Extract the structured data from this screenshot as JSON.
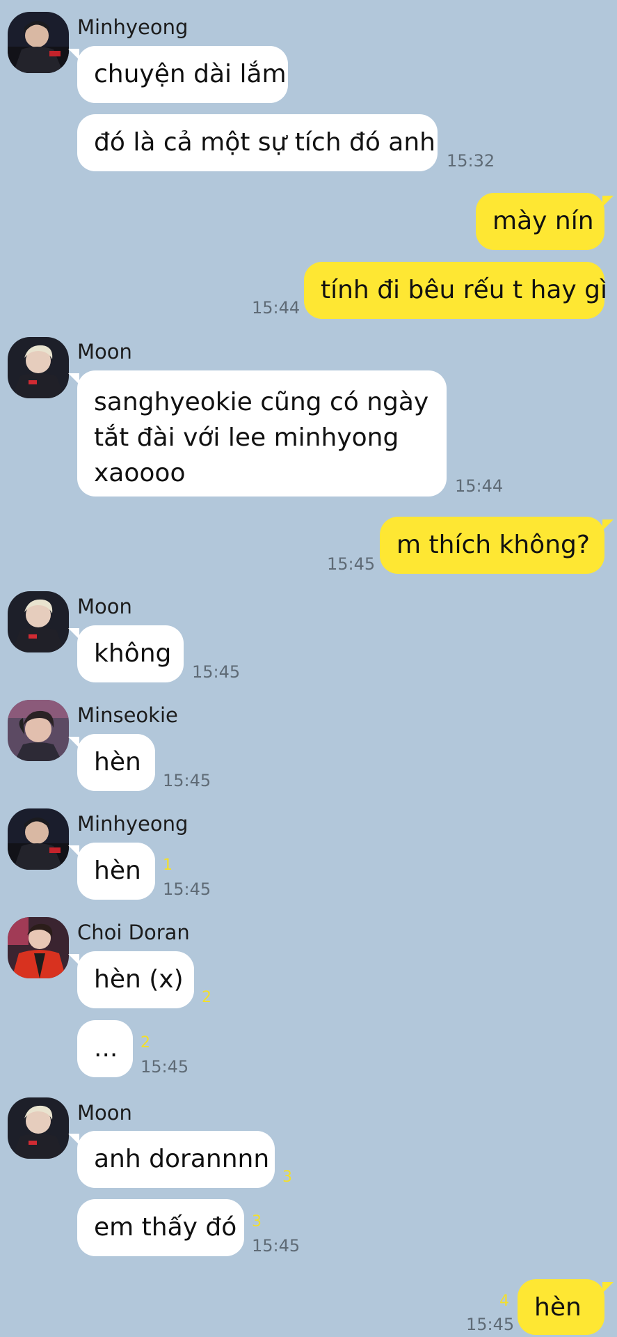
{
  "senders": {
    "minhyeong": "Minhyeong",
    "moon": "Moon",
    "minseokie": "Minseokie",
    "choi_doran": "Choi Doran"
  },
  "avatars": {
    "minhyeong": "minhyeong-avatar-photo",
    "moon": "moon-avatar-photo",
    "minseokie": "minseokie-avatar-photo",
    "choi_doran": "choi-doran-avatar-photo"
  },
  "messages": [
    {
      "side": "in",
      "sender": "Minhyeong",
      "text": "chuyện dài lắm",
      "time": "",
      "unread": ""
    },
    {
      "side": "in",
      "sender": "Minhyeong",
      "text": "đó là cả một sự tích đó anh",
      "time": "15:32",
      "unread": ""
    },
    {
      "side": "out",
      "sender": "",
      "text": "mày nín",
      "time": "",
      "unread": ""
    },
    {
      "side": "out",
      "sender": "",
      "text": "tính đi bêu rếu t hay gì",
      "time": "15:44",
      "unread": ""
    },
    {
      "side": "in",
      "sender": "Moon",
      "text": "sanghyeokie cũng có ngày tắt đài với lee minhyong xaoooo",
      "time": "15:44",
      "unread": ""
    },
    {
      "side": "out",
      "sender": "",
      "text": "m thích không?",
      "time": "15:45",
      "unread": ""
    },
    {
      "side": "in",
      "sender": "Moon",
      "text": "không",
      "time": "15:45",
      "unread": ""
    },
    {
      "side": "in",
      "sender": "Minseokie",
      "text": "hèn",
      "time": "15:45",
      "unread": ""
    },
    {
      "side": "in",
      "sender": "Minhyeong",
      "text": "hèn",
      "time": "15:45",
      "unread": "1"
    },
    {
      "side": "in",
      "sender": "Choi Doran",
      "text": "hèn (x)",
      "time": "",
      "unread": "2"
    },
    {
      "side": "in",
      "sender": "Choi Doran",
      "text": "...",
      "time": "15:45",
      "unread": "2"
    },
    {
      "side": "in",
      "sender": "Moon",
      "text": "anh dorannnn",
      "time": "",
      "unread": "3"
    },
    {
      "side": "in",
      "sender": "Moon",
      "text": "em thấy đó",
      "time": "15:45",
      "unread": "3"
    },
    {
      "side": "out",
      "sender": "",
      "text": "hèn",
      "time": "15:45",
      "unread": "4"
    }
  ],
  "colors": {
    "background": "#b2c7da",
    "incoming_bubble": "#ffffff",
    "outgoing_bubble": "#fee733",
    "timestamp": "#5f6b76",
    "unread_count": "#f3df2a"
  }
}
